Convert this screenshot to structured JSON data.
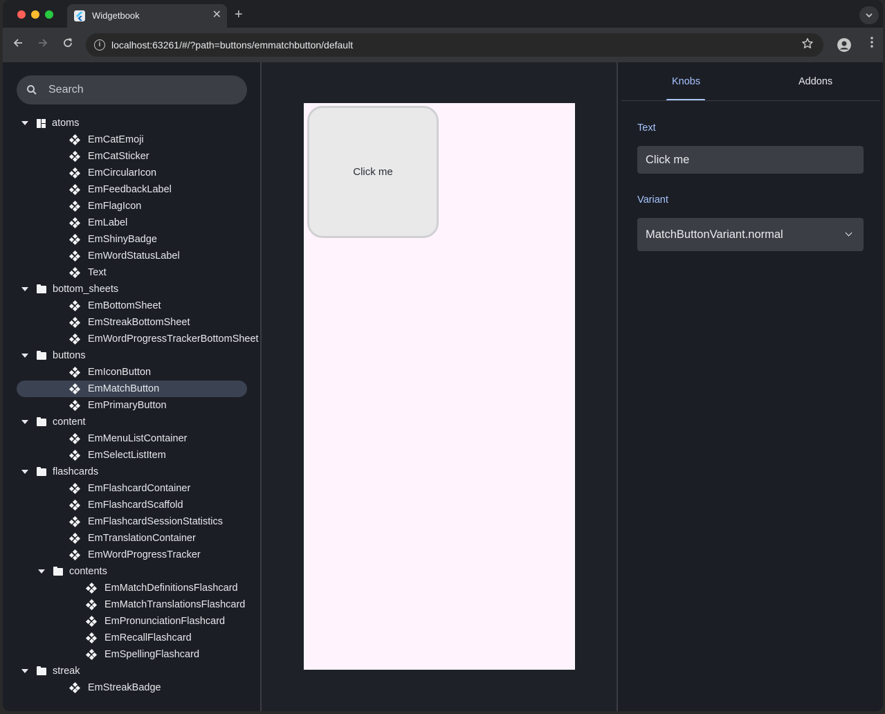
{
  "browser": {
    "tab_title": "Widgetbook",
    "tab_close": "✕",
    "new_tab": "+",
    "url": "localhost:63261/#/?path=buttons/emmatchbutton/default"
  },
  "sidebar": {
    "search_placeholder": "Search",
    "tree": [
      {
        "label": "atoms",
        "type": "category",
        "depth": 0
      },
      {
        "label": "EmCatEmoji",
        "type": "widget",
        "depth": 1
      },
      {
        "label": "EmCatSticker",
        "type": "widget",
        "depth": 1
      },
      {
        "label": "EmCircularIcon",
        "type": "widget",
        "depth": 1
      },
      {
        "label": "EmFeedbackLabel",
        "type": "widget",
        "depth": 1
      },
      {
        "label": "EmFlagIcon",
        "type": "widget",
        "depth": 1
      },
      {
        "label": "EmLabel",
        "type": "widget",
        "depth": 1
      },
      {
        "label": "EmShinyBadge",
        "type": "widget",
        "depth": 1
      },
      {
        "label": "EmWordStatusLabel",
        "type": "widget",
        "depth": 1
      },
      {
        "label": "Text",
        "type": "widget",
        "depth": 1
      },
      {
        "label": "bottom_sheets",
        "type": "folder",
        "depth": 0
      },
      {
        "label": "EmBottomSheet",
        "type": "widget",
        "depth": 1
      },
      {
        "label": "EmStreakBottomSheet",
        "type": "widget",
        "depth": 1
      },
      {
        "label": "EmWordProgressTrackerBottomSheet",
        "type": "widget",
        "depth": 1
      },
      {
        "label": "buttons",
        "type": "folder",
        "depth": 0
      },
      {
        "label": "EmIconButton",
        "type": "widget",
        "depth": 1
      },
      {
        "label": "EmMatchButton",
        "type": "widget",
        "depth": 1,
        "selected": true
      },
      {
        "label": "EmPrimaryButton",
        "type": "widget",
        "depth": 1
      },
      {
        "label": "content",
        "type": "folder",
        "depth": 0
      },
      {
        "label": "EmMenuListContainer",
        "type": "widget",
        "depth": 1
      },
      {
        "label": "EmSelectListItem",
        "type": "widget",
        "depth": 1
      },
      {
        "label": "flashcards",
        "type": "folder",
        "depth": 0
      },
      {
        "label": "EmFlashcardContainer",
        "type": "widget",
        "depth": 1
      },
      {
        "label": "EmFlashcardScaffold",
        "type": "widget",
        "depth": 1
      },
      {
        "label": "EmFlashcardSessionStatistics",
        "type": "widget",
        "depth": 1
      },
      {
        "label": "EmTranslationContainer",
        "type": "widget",
        "depth": 1
      },
      {
        "label": "EmWordProgressTracker",
        "type": "widget",
        "depth": 1
      },
      {
        "label": "contents",
        "type": "folder",
        "depth": 1
      },
      {
        "label": "EmMatchDefinitionsFlashcard",
        "type": "widget",
        "depth": 2
      },
      {
        "label": "EmMatchTranslationsFlashcard",
        "type": "widget",
        "depth": 2
      },
      {
        "label": "EmPronunciationFlashcard",
        "type": "widget",
        "depth": 2
      },
      {
        "label": "EmRecallFlashcard",
        "type": "widget",
        "depth": 2
      },
      {
        "label": "EmSpellingFlashcard",
        "type": "widget",
        "depth": 2
      },
      {
        "label": "streak",
        "type": "folder",
        "depth": 0
      },
      {
        "label": "EmStreakBadge",
        "type": "widget",
        "depth": 1
      }
    ]
  },
  "preview": {
    "button_label": "Click me"
  },
  "panel": {
    "tabs": [
      {
        "label": "Knobs",
        "active": true
      },
      {
        "label": "Addons",
        "active": false
      }
    ],
    "knobs": {
      "text_label": "Text",
      "text_value": "Click me",
      "variant_label": "Variant",
      "variant_value": "MatchButtonVariant.normal"
    }
  },
  "colors": {
    "accent": "#a7c3ff",
    "selected_row": "#3b4252",
    "device_bg": "#fff4fd"
  }
}
